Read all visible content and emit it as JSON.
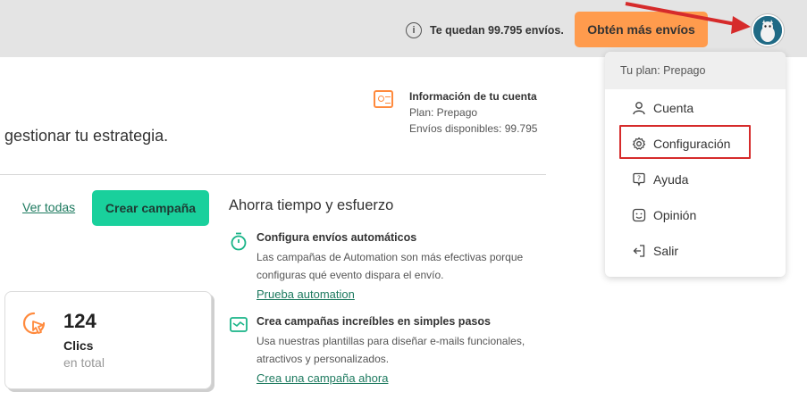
{
  "topbar": {
    "quota_text": "Te quedan 99.795 envíos.",
    "cta_label": "Obtén más envíos"
  },
  "main": {
    "intro_text": "gestionar tu estrategia.",
    "account": {
      "title": "Información de tu cuenta",
      "plan": "Plan: Prepago",
      "available": "Envíos disponibles: 99.795"
    },
    "ver_todas": "Ver todas",
    "crear_campana": "Crear campaña",
    "stats": {
      "value": "124",
      "label": "Clics",
      "sub": "en total"
    },
    "side_title": "Ahorra tiempo y esfuerzo",
    "features": [
      {
        "title": "Configura envíos automáticos",
        "description": "Las campañas de Automation son más efectivas porque configuras qué evento dispara el envío.",
        "link": "Prueba automation"
      },
      {
        "title": "Crea campañas increíbles en simples pasos",
        "description": "Usa nuestras plantillas para diseñar e-mails funcionales, atractivos y personalizados.",
        "link": "Crea una campaña ahora"
      }
    ]
  },
  "dropdown": {
    "plan_label": "Tu plan: Prepago",
    "items": [
      {
        "label": "Cuenta",
        "icon": "user-icon"
      },
      {
        "label": "Configuración",
        "icon": "gear-icon"
      },
      {
        "label": "Ayuda",
        "icon": "help-icon"
      },
      {
        "label": "Opinión",
        "icon": "feedback-icon"
      },
      {
        "label": "Salir",
        "icon": "logout-icon"
      }
    ]
  },
  "colors": {
    "cta": "#ff9b4d",
    "primary": "#19d09c",
    "link": "#1d7a5f",
    "annotation": "#d62b2b"
  }
}
